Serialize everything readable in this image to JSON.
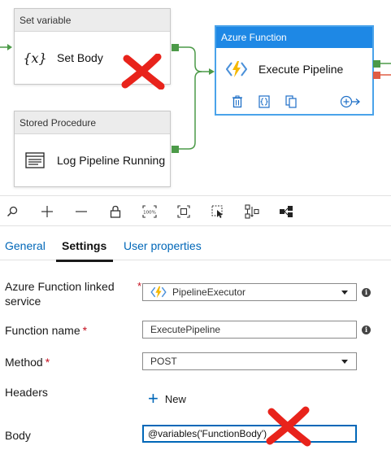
{
  "canvas": {
    "set_variable": {
      "header": "Set variable",
      "icon_text": "{x}",
      "name": "Set Body"
    },
    "stored_procedure": {
      "header": "Stored Procedure",
      "name": "Log Pipeline Running"
    },
    "azure_function": {
      "header": "Azure Function",
      "name": "Execute Pipeline"
    }
  },
  "tabs": [
    "General",
    "Settings",
    "User properties"
  ],
  "form": {
    "linked_service": {
      "label_line1": "Azure Function linked",
      "label_line2": "service",
      "value": "PipelineExecutor"
    },
    "function_name": {
      "label": "Function name",
      "value": "ExecutePipeline"
    },
    "method": {
      "label": "Method",
      "value": "POST"
    },
    "headers": {
      "label": "Headers",
      "new_label": "New"
    },
    "body": {
      "label": "Body",
      "value": "@variables('FunctionBody')"
    },
    "required_marker": "*"
  },
  "colors": {
    "accent": "#1e88e5",
    "link": "#0067b8",
    "success_port": "#4c9a48",
    "failure_port": "#e05d44",
    "x_mark": "#e8231b"
  }
}
